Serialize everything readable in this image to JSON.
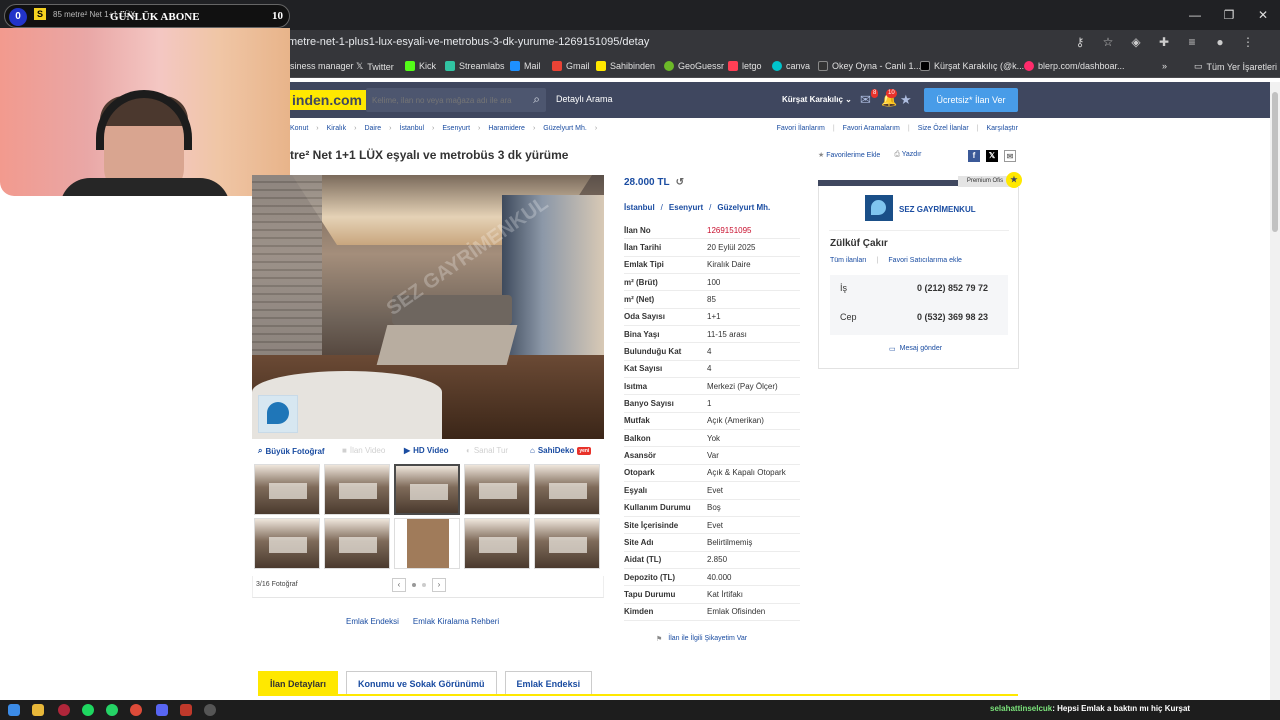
{
  "browser": {
    "tab_title": "85 metre² Net 1+1 LÜX",
    "url": "metre-net-1-plus1-lux-esyali-ve-metrobus-3-dk-yurume-1269151095/detay",
    "bookmarks": [
      "isiness manager",
      "Twitter",
      "Kick",
      "Streamlabs",
      "Mail",
      "Gmail",
      "Sahibinden",
      "GeoGuessr",
      "letgo",
      "canva",
      "Okey Oyna - Canlı 1...",
      "Kürşat Karakılıç (@k...",
      "blerp.com/dashboar..."
    ],
    "all_bookmarks": "Tüm Yer İşaretleri"
  },
  "overlay": {
    "count_left": "0",
    "label": "GÜNLÜK ABONE",
    "count_right": "10"
  },
  "header": {
    "logo": "inden.com",
    "search_placeholder": "Kelime, ilan no veya mağaza adı ile ara",
    "detailed_search": "Detaylı Arama",
    "user": "Kürşat Karakılıç",
    "badge_msgs": "8",
    "badge_notif": "10",
    "cta": "Ücretsiz* İlan Ver"
  },
  "breadcrumb": [
    "Konut",
    "Kiralık",
    "Daire",
    "İstanbul",
    "Esenyurt",
    "Haramidere",
    "Güzelyurt Mh."
  ],
  "breadcrumb_right": [
    "Favori İlanlarım",
    "Favori Aramalarım",
    "Size Özel İlanlar",
    "Karşılaştır"
  ],
  "listing": {
    "title": "tre² Net 1+1 LÜX eşyalı ve metrobüs 3 dk yürüme",
    "favorite": "Favorilerime Ekle",
    "print": "Yazdır",
    "price": "28.000 TL",
    "location": [
      "İstanbul",
      "Esenyurt",
      "Güzelyurt Mh."
    ],
    "photo_watermark": "SEZ GAYRİMENKUL",
    "photo_tools": {
      "big_photo": "Büyük Fotoğraf",
      "video": "İlan Video",
      "hd_video": "HD Video",
      "virtual_tour": "Sanal Tur",
      "sahideko": "SahiDeko",
      "yeni": "yeni"
    },
    "photo_counter": "3/16 Fotoğraf",
    "extra_links": [
      "Emlak Endeksi",
      "Emlak Kiralama Rehberi"
    ],
    "complaint": "İlan ile İlgili Şikayetim Var"
  },
  "details": [
    {
      "k": "İlan No",
      "v": "1269151095",
      "red": true
    },
    {
      "k": "İlan Tarihi",
      "v": "20 Eylül 2025"
    },
    {
      "k": "Emlak Tipi",
      "v": "Kiralık Daire"
    },
    {
      "k": "m² (Brüt)",
      "v": "100"
    },
    {
      "k": "m² (Net)",
      "v": "85"
    },
    {
      "k": "Oda Sayısı",
      "v": "1+1"
    },
    {
      "k": "Bina Yaşı",
      "v": "11-15 arası"
    },
    {
      "k": "Bulunduğu Kat",
      "v": "4"
    },
    {
      "k": "Kat Sayısı",
      "v": "4"
    },
    {
      "k": "Isıtma",
      "v": "Merkezi (Pay Ölçer)"
    },
    {
      "k": "Banyo Sayısı",
      "v": "1"
    },
    {
      "k": "Mutfak",
      "v": "Açık (Amerikan)"
    },
    {
      "k": "Balkon",
      "v": "Yok"
    },
    {
      "k": "Asansör",
      "v": "Var"
    },
    {
      "k": "Otopark",
      "v": "Açık & Kapalı Otopark"
    },
    {
      "k": "Eşyalı",
      "v": "Evet"
    },
    {
      "k": "Kullanım Durumu",
      "v": "Boş"
    },
    {
      "k": "Site İçerisinde",
      "v": "Evet"
    },
    {
      "k": "Site Adı",
      "v": "Belirtilmemiş"
    },
    {
      "k": "Aidat (TL)",
      "v": "2.850"
    },
    {
      "k": "Depozito (TL)",
      "v": "40.000"
    },
    {
      "k": "Tapu Durumu",
      "v": "Kat İrtifakı"
    },
    {
      "k": "Kimden",
      "v": "Emlak Ofisinden"
    }
  ],
  "seller": {
    "premium": "Premium Ofis",
    "firm": "SEZ GAYRİMENKUL",
    "name": "Zülküf Çakır",
    "all_listings": "Tüm ilanları",
    "fav_seller": "Favori Satıcılarıma ekle",
    "work_label": "İş",
    "work_phone": "0 (212) 852 79 72",
    "mobile_label": "Cep",
    "mobile_phone": "0 (532) 369 98 23",
    "message": "Mesaj gönder"
  },
  "tabs": [
    "İlan Detayları",
    "Konumu ve Sokak Görünümü",
    "Emlak Endeksi"
  ],
  "chat": {
    "user": "selahattinselcuk",
    "message": ": Hepsi Emlak a baktın mı hiç Kurşat"
  }
}
